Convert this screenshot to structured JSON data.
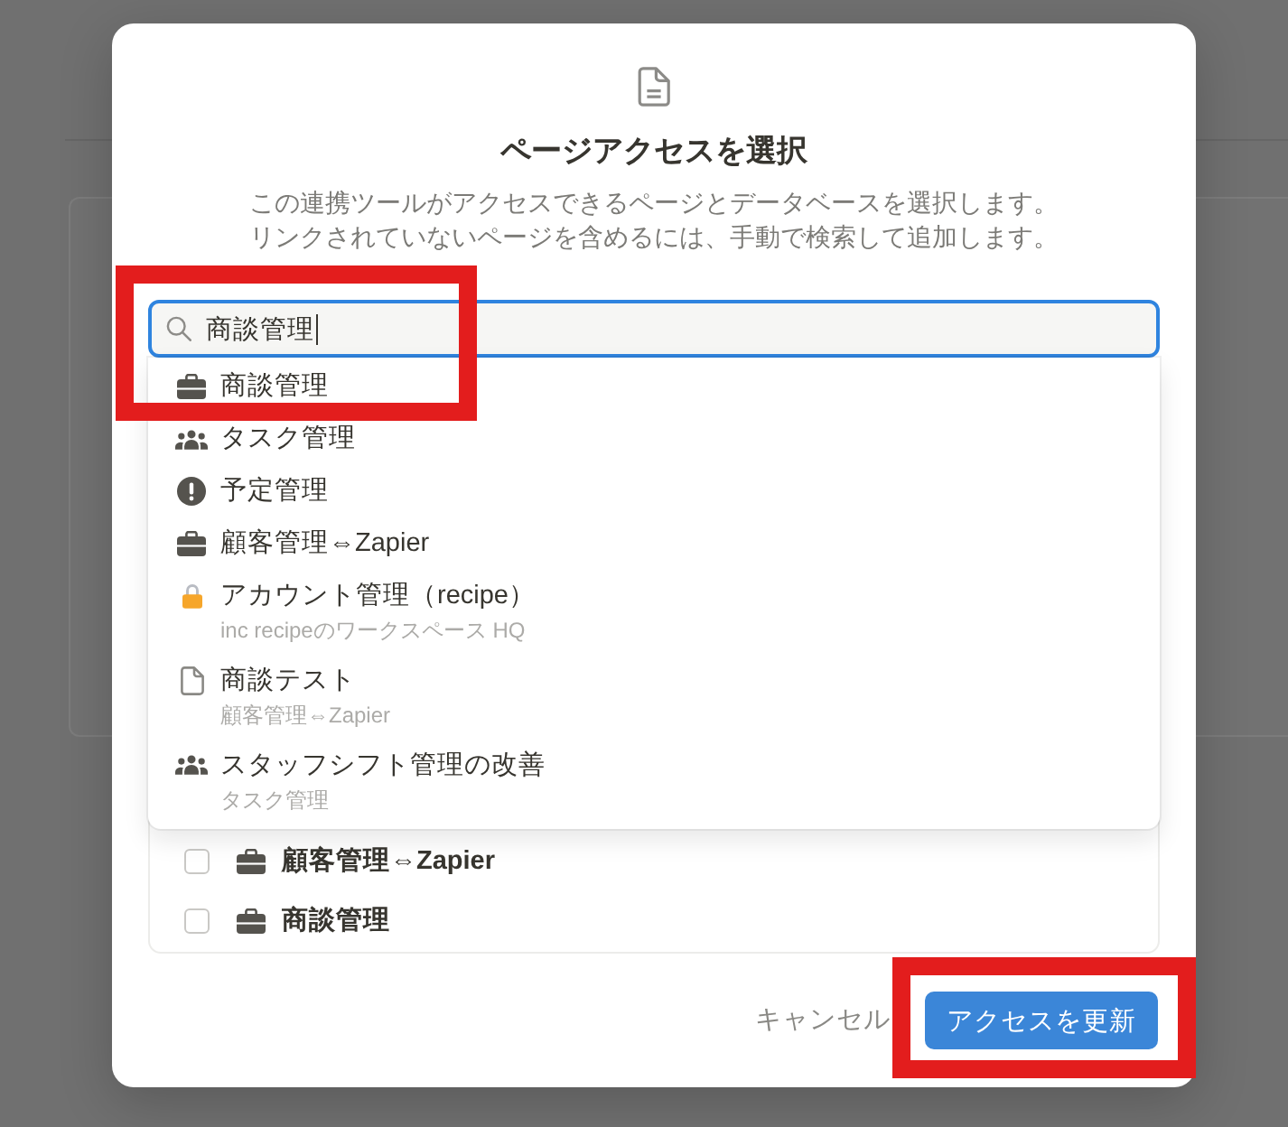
{
  "dialog": {
    "title": "ページアクセスを選択",
    "description": [
      "この連携ツールがアクセスできるページとデータベースを選択します。",
      "リンクされていないページを含めるには、手動で検索して追加します。"
    ]
  },
  "search": {
    "value": "商談管理",
    "focused": true,
    "highlighted": true
  },
  "results": [
    {
      "kind": "briefcase",
      "title": "商談管理"
    },
    {
      "kind": "people",
      "title": "タスク管理"
    },
    {
      "kind": "alert",
      "title": "予定管理"
    },
    {
      "kind": "briefcase",
      "title": "顧客管理⇔Zapier"
    },
    {
      "kind": "lock",
      "title": "アカウント管理（recipe）",
      "subtitle": "inc recipeのワークスペース HQ"
    },
    {
      "kind": "page",
      "title": "商談テスト",
      "subtitle": "顧客管理⇔Zapier"
    },
    {
      "kind": "people",
      "title": "スタッフシフト管理の改善",
      "subtitle": "タスク管理"
    }
  ],
  "selected_pages": [
    {
      "kind": "briefcase",
      "title": "顧客管理⇔Zapier",
      "checked": false
    },
    {
      "kind": "briefcase",
      "title": "商談管理",
      "checked": false
    }
  ],
  "footer": {
    "cancel_label": "キャンセル",
    "update_button": {
      "label": "アクセスを更新",
      "highlighted": true
    }
  }
}
